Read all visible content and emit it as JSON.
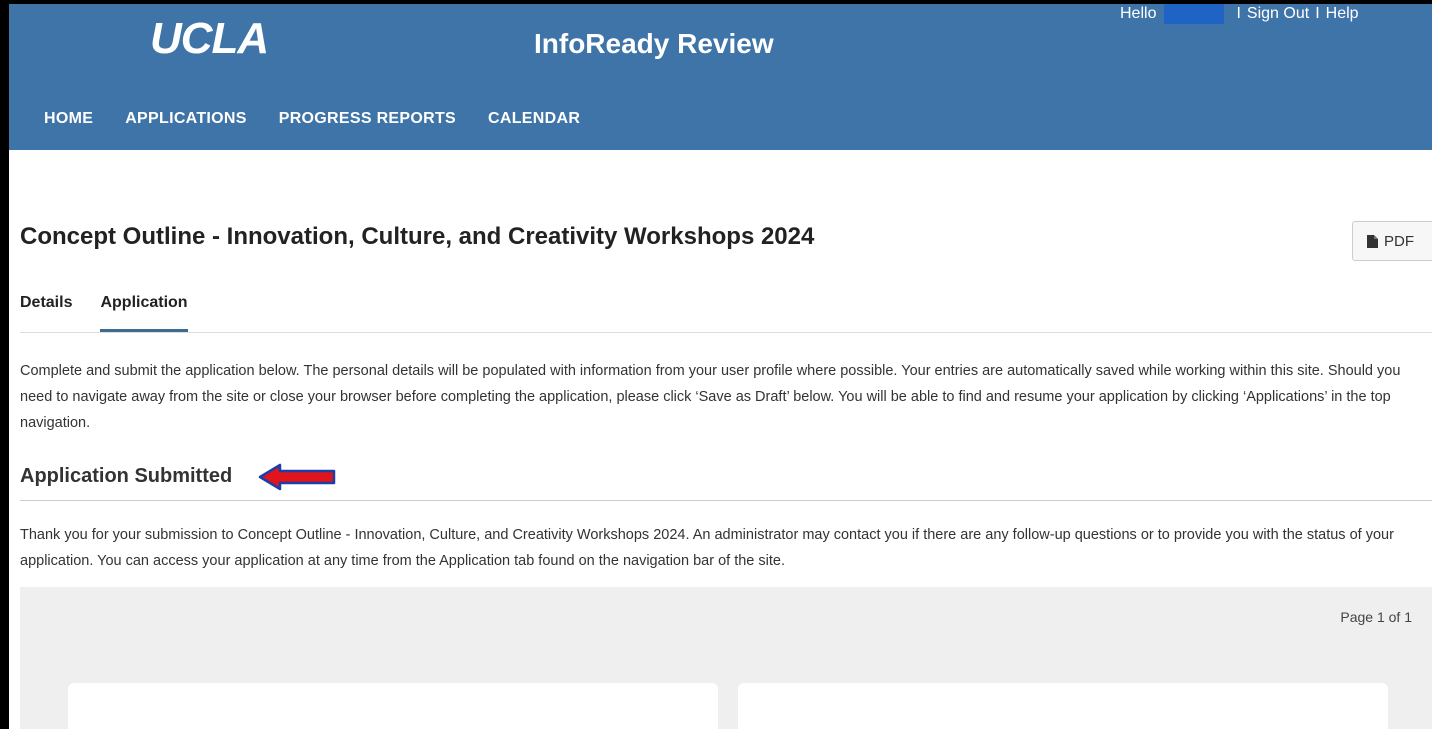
{
  "header": {
    "logo": "UCLA",
    "app_title": "InfoReady Review",
    "greeting": "Hello",
    "sign_out": "Sign Out",
    "help": "Help",
    "separator": "I",
    "background_color": "#3f74a8"
  },
  "nav": {
    "items": [
      {
        "label": "HOME"
      },
      {
        "label": "APPLICATIONS"
      },
      {
        "label": "PROGRESS REPORTS"
      },
      {
        "label": "CALENDAR"
      }
    ]
  },
  "page": {
    "title": "Concept Outline - Innovation, Culture, and Creativity Workshops 2024",
    "pdf_label": "PDF",
    "pdf_icon": "file-icon"
  },
  "tabs": [
    {
      "label": "Details",
      "active": false
    },
    {
      "label": "Application",
      "active": true
    }
  ],
  "intro_text": "Complete and submit the application below. The personal details will be populated with information from your user profile where possible. Your entries are automatically saved while working within this site. Should you need to navigate away from the site or close your browser before completing the application, please click ‘Save as Draft’ below. You will be able to find and resume your application by clicking ‘Applications’ in the top navigation.",
  "submission": {
    "heading": "Application Submitted",
    "arrow_color": "#e0141b",
    "message": "Thank you for your submission to Concept Outline - Innovation, Culture, and Creativity Workshops 2024. An administrator may contact you if there are any follow-up questions or to provide you with the status of your application. You can access your application at any time from the Application tab found on the navigation bar of the site."
  },
  "pagination": {
    "label": "Page 1 of 1"
  }
}
